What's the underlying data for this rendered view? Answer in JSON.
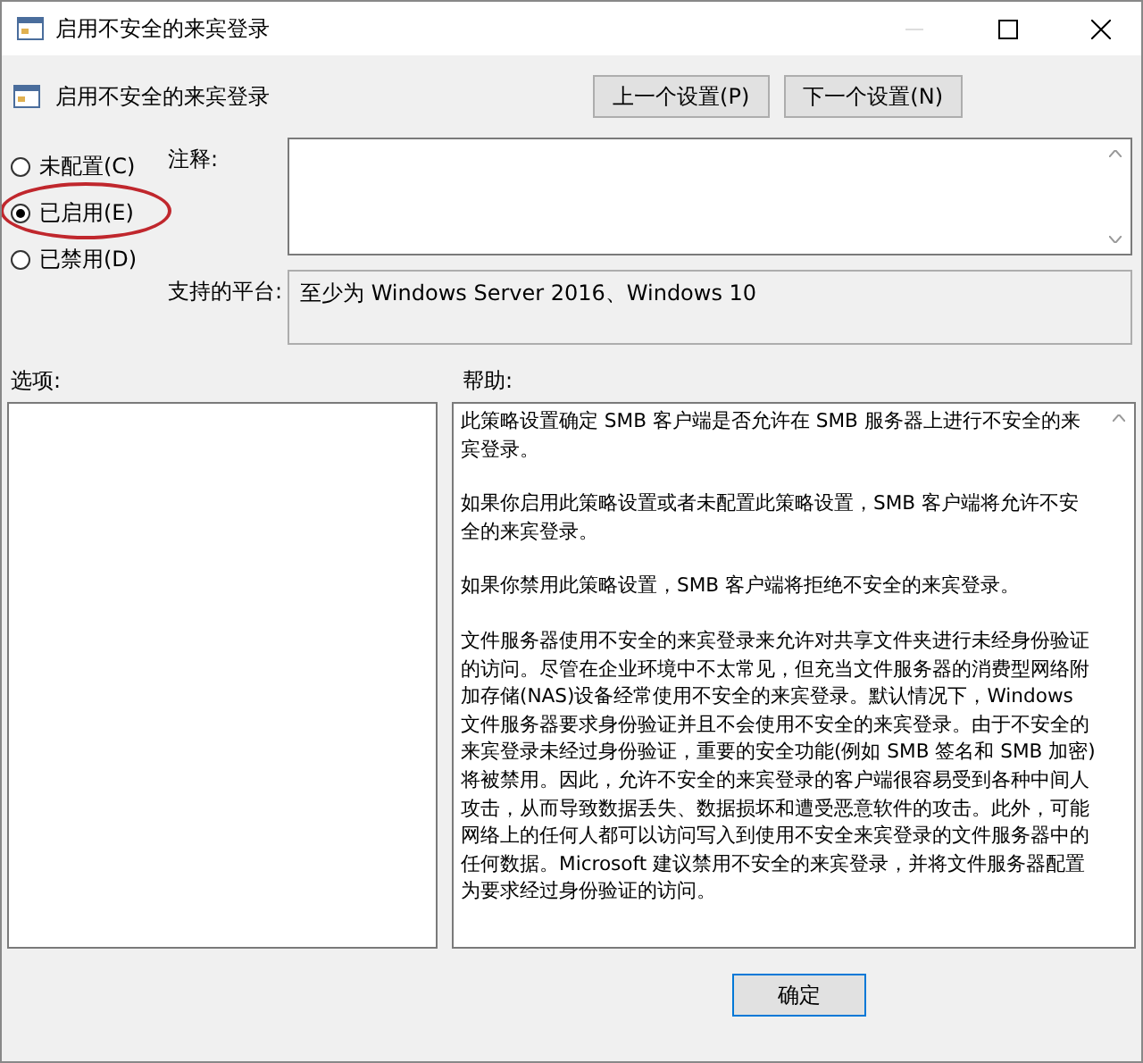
{
  "window": {
    "title": "启用不安全的来宾登录"
  },
  "header": {
    "title": "启用不安全的来宾登录",
    "buttons": [
      "上一个设置(P)",
      "下一个设置(N)"
    ]
  },
  "options": [
    {
      "label": "未配置(C)",
      "selected": false,
      "highlighted": false
    },
    {
      "label": "已启用(E)",
      "selected": true,
      "highlighted": true
    },
    {
      "label": "已禁用(D)",
      "selected": false,
      "highlighted": false
    }
  ],
  "comment": {
    "label": "注释:"
  },
  "platform": {
    "label": "支持的平台:",
    "value": "至少为 Windows Server 2016、Windows 10"
  },
  "options_label": "选项:",
  "help_label": "帮助:",
  "help": [
    "此策略设置确定 SMB 客户端是否允许在 SMB 服务器上进行不安全的来宾登录。",
    "如果你启用此策略设置或者未配置此策略设置，SMB 客户端将允许不安全的来宾登录。",
    "如果你禁用此策略设置，SMB 客户端将拒绝不安全的来宾登录。",
    "文件服务器使用不安全的来宾登录来允许对共享文件夹进行未经身份验证的访问。尽管在企业环境中不太常见，但充当文件服务器的消费型网络附加存储(NAS)设备经常使用不安全的来宾登录。默认情况下，Windows 文件服务器要求身份验证并且不会使用不安全的来宾登录。由于不安全的来宾登录未经过身份验证，重要的安全功能(例如 SMB 签名和 SMB 加密)将被禁用。因此，允许不安全的来宾登录的客户端很容易受到各种中间人攻击，从而导致数据丢失、数据损坏和遭受恶意软件的攻击。此外，可能网络上的任何人都可以访问写入到使用不安全来宾登录的文件服务器中的任何数据。Microsoft 建议禁用不安全的来宾登录，并将文件服务器配置为要求经过身份验证的访问。"
  ],
  "footer_buttons": [
    "确定"
  ]
}
